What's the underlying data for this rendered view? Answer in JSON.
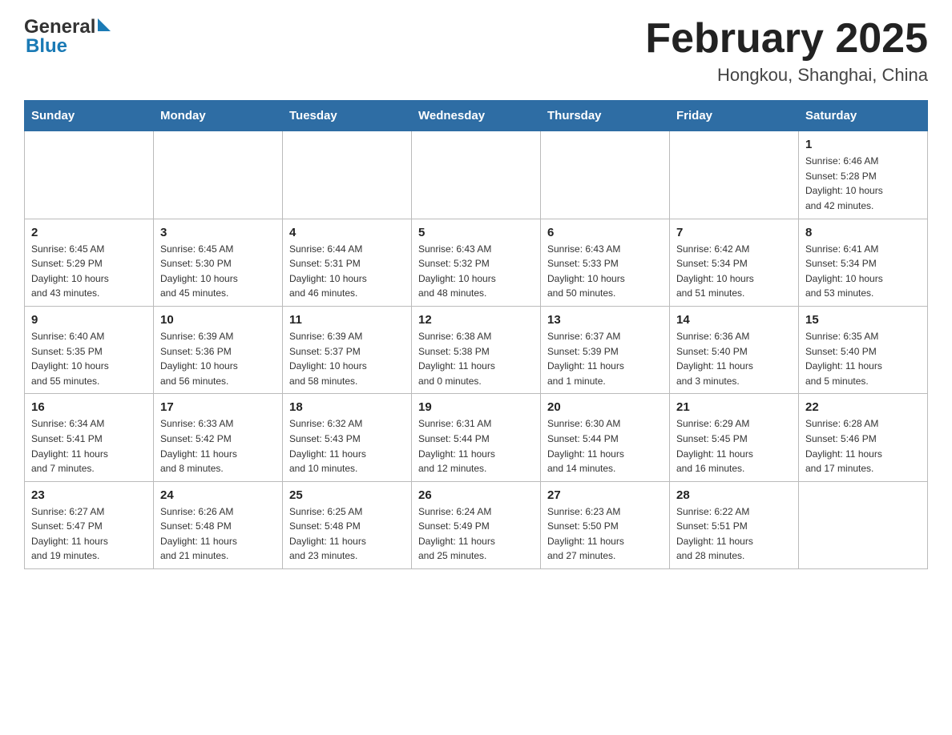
{
  "header": {
    "title": "February 2025",
    "subtitle": "Hongkou, Shanghai, China",
    "logo_general": "General",
    "logo_blue": "Blue"
  },
  "days_of_week": [
    "Sunday",
    "Monday",
    "Tuesday",
    "Wednesday",
    "Thursday",
    "Friday",
    "Saturday"
  ],
  "weeks": [
    {
      "days": [
        {
          "number": "",
          "info": ""
        },
        {
          "number": "",
          "info": ""
        },
        {
          "number": "",
          "info": ""
        },
        {
          "number": "",
          "info": ""
        },
        {
          "number": "",
          "info": ""
        },
        {
          "number": "",
          "info": ""
        },
        {
          "number": "1",
          "info": "Sunrise: 6:46 AM\nSunset: 5:28 PM\nDaylight: 10 hours\nand 42 minutes."
        }
      ]
    },
    {
      "days": [
        {
          "number": "2",
          "info": "Sunrise: 6:45 AM\nSunset: 5:29 PM\nDaylight: 10 hours\nand 43 minutes."
        },
        {
          "number": "3",
          "info": "Sunrise: 6:45 AM\nSunset: 5:30 PM\nDaylight: 10 hours\nand 45 minutes."
        },
        {
          "number": "4",
          "info": "Sunrise: 6:44 AM\nSunset: 5:31 PM\nDaylight: 10 hours\nand 46 minutes."
        },
        {
          "number": "5",
          "info": "Sunrise: 6:43 AM\nSunset: 5:32 PM\nDaylight: 10 hours\nand 48 minutes."
        },
        {
          "number": "6",
          "info": "Sunrise: 6:43 AM\nSunset: 5:33 PM\nDaylight: 10 hours\nand 50 minutes."
        },
        {
          "number": "7",
          "info": "Sunrise: 6:42 AM\nSunset: 5:34 PM\nDaylight: 10 hours\nand 51 minutes."
        },
        {
          "number": "8",
          "info": "Sunrise: 6:41 AM\nSunset: 5:34 PM\nDaylight: 10 hours\nand 53 minutes."
        }
      ]
    },
    {
      "days": [
        {
          "number": "9",
          "info": "Sunrise: 6:40 AM\nSunset: 5:35 PM\nDaylight: 10 hours\nand 55 minutes."
        },
        {
          "number": "10",
          "info": "Sunrise: 6:39 AM\nSunset: 5:36 PM\nDaylight: 10 hours\nand 56 minutes."
        },
        {
          "number": "11",
          "info": "Sunrise: 6:39 AM\nSunset: 5:37 PM\nDaylight: 10 hours\nand 58 minutes."
        },
        {
          "number": "12",
          "info": "Sunrise: 6:38 AM\nSunset: 5:38 PM\nDaylight: 11 hours\nand 0 minutes."
        },
        {
          "number": "13",
          "info": "Sunrise: 6:37 AM\nSunset: 5:39 PM\nDaylight: 11 hours\nand 1 minute."
        },
        {
          "number": "14",
          "info": "Sunrise: 6:36 AM\nSunset: 5:40 PM\nDaylight: 11 hours\nand 3 minutes."
        },
        {
          "number": "15",
          "info": "Sunrise: 6:35 AM\nSunset: 5:40 PM\nDaylight: 11 hours\nand 5 minutes."
        }
      ]
    },
    {
      "days": [
        {
          "number": "16",
          "info": "Sunrise: 6:34 AM\nSunset: 5:41 PM\nDaylight: 11 hours\nand 7 minutes."
        },
        {
          "number": "17",
          "info": "Sunrise: 6:33 AM\nSunset: 5:42 PM\nDaylight: 11 hours\nand 8 minutes."
        },
        {
          "number": "18",
          "info": "Sunrise: 6:32 AM\nSunset: 5:43 PM\nDaylight: 11 hours\nand 10 minutes."
        },
        {
          "number": "19",
          "info": "Sunrise: 6:31 AM\nSunset: 5:44 PM\nDaylight: 11 hours\nand 12 minutes."
        },
        {
          "number": "20",
          "info": "Sunrise: 6:30 AM\nSunset: 5:44 PM\nDaylight: 11 hours\nand 14 minutes."
        },
        {
          "number": "21",
          "info": "Sunrise: 6:29 AM\nSunset: 5:45 PM\nDaylight: 11 hours\nand 16 minutes."
        },
        {
          "number": "22",
          "info": "Sunrise: 6:28 AM\nSunset: 5:46 PM\nDaylight: 11 hours\nand 17 minutes."
        }
      ]
    },
    {
      "days": [
        {
          "number": "23",
          "info": "Sunrise: 6:27 AM\nSunset: 5:47 PM\nDaylight: 11 hours\nand 19 minutes."
        },
        {
          "number": "24",
          "info": "Sunrise: 6:26 AM\nSunset: 5:48 PM\nDaylight: 11 hours\nand 21 minutes."
        },
        {
          "number": "25",
          "info": "Sunrise: 6:25 AM\nSunset: 5:48 PM\nDaylight: 11 hours\nand 23 minutes."
        },
        {
          "number": "26",
          "info": "Sunrise: 6:24 AM\nSunset: 5:49 PM\nDaylight: 11 hours\nand 25 minutes."
        },
        {
          "number": "27",
          "info": "Sunrise: 6:23 AM\nSunset: 5:50 PM\nDaylight: 11 hours\nand 27 minutes."
        },
        {
          "number": "28",
          "info": "Sunrise: 6:22 AM\nSunset: 5:51 PM\nDaylight: 11 hours\nand 28 minutes."
        },
        {
          "number": "",
          "info": ""
        }
      ]
    }
  ]
}
